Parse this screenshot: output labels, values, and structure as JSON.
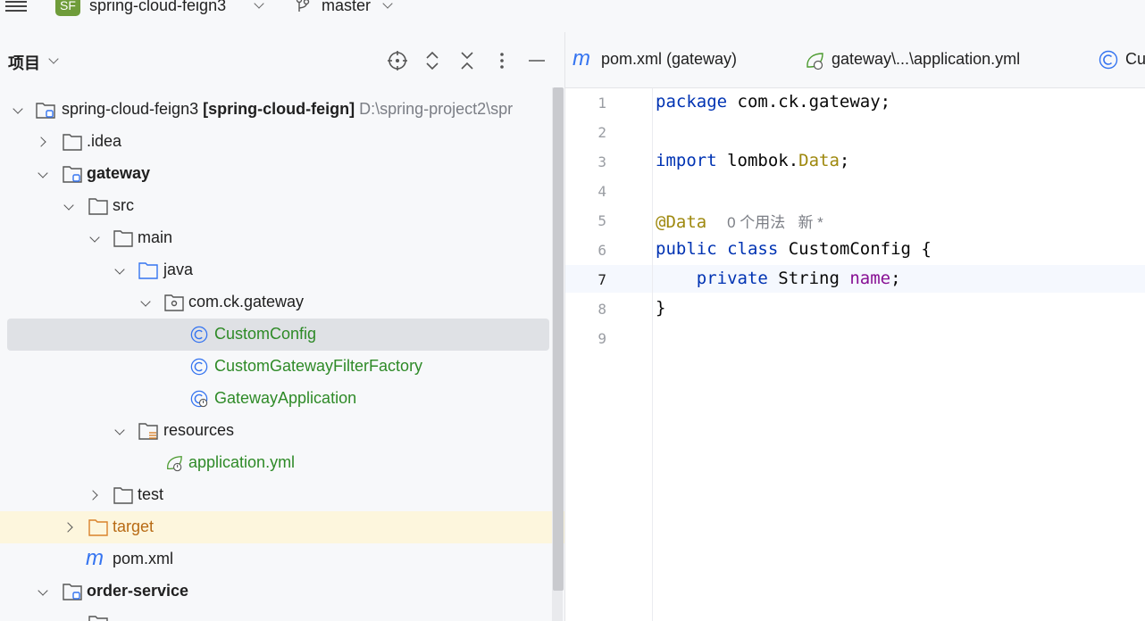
{
  "topbar": {
    "project_badge": "SF",
    "project_name": "spring-cloud-feign3",
    "branch": "master"
  },
  "project_panel": {
    "title": "项目",
    "tools": [
      "locate-icon",
      "expand-all-icon",
      "collapse-all-icon",
      "more-icon",
      "minimize-icon"
    ],
    "tree": {
      "root_name": "spring-cloud-feign3",
      "root_module": "[spring-cloud-feign]",
      "root_path": "D:\\spring-project2\\spr",
      "idea": ".idea",
      "gateway": "gateway",
      "src": "src",
      "main": "main",
      "java": "java",
      "package": "com.ck.gateway",
      "class1": "CustomConfig",
      "class2": "CustomGatewayFilterFactory",
      "class3": "GatewayApplication",
      "resources": "resources",
      "yml": "application.yml",
      "test": "test",
      "target": "target",
      "pom": "pom.xml",
      "order_service": "order-service"
    }
  },
  "editor": {
    "tabs": [
      "pom.xml (gateway)",
      "gateway\\...\\application.yml",
      "Cu"
    ],
    "line_numbers": [
      "1",
      "2",
      "3",
      "4",
      "5",
      "6",
      "7",
      "8",
      "9"
    ],
    "code": {
      "l1_kw": "package",
      "l1_rest": " com.ck.gateway;",
      "l3_kw": "import",
      "l3_mid": " lombok.",
      "l3_ann": "Data",
      "l3_end": ";",
      "l5_ann": "@Data",
      "l5_hint": "0 个用法   新 *",
      "l6_kw": "public class",
      "l6_rest": " CustomConfig {",
      "l7_kw": "private",
      "l7_mid": " String ",
      "l7_field": "name",
      "l7_end": ";",
      "l8": "}"
    }
  },
  "colors": {
    "keyword": "#0033b3",
    "annotation": "#9e880d",
    "field": "#871094",
    "class_green": "#2e8a27",
    "excluded_orange": "#b86a14",
    "selection": "#dfe1e5",
    "excluded_bg": "#fdf6dd"
  }
}
